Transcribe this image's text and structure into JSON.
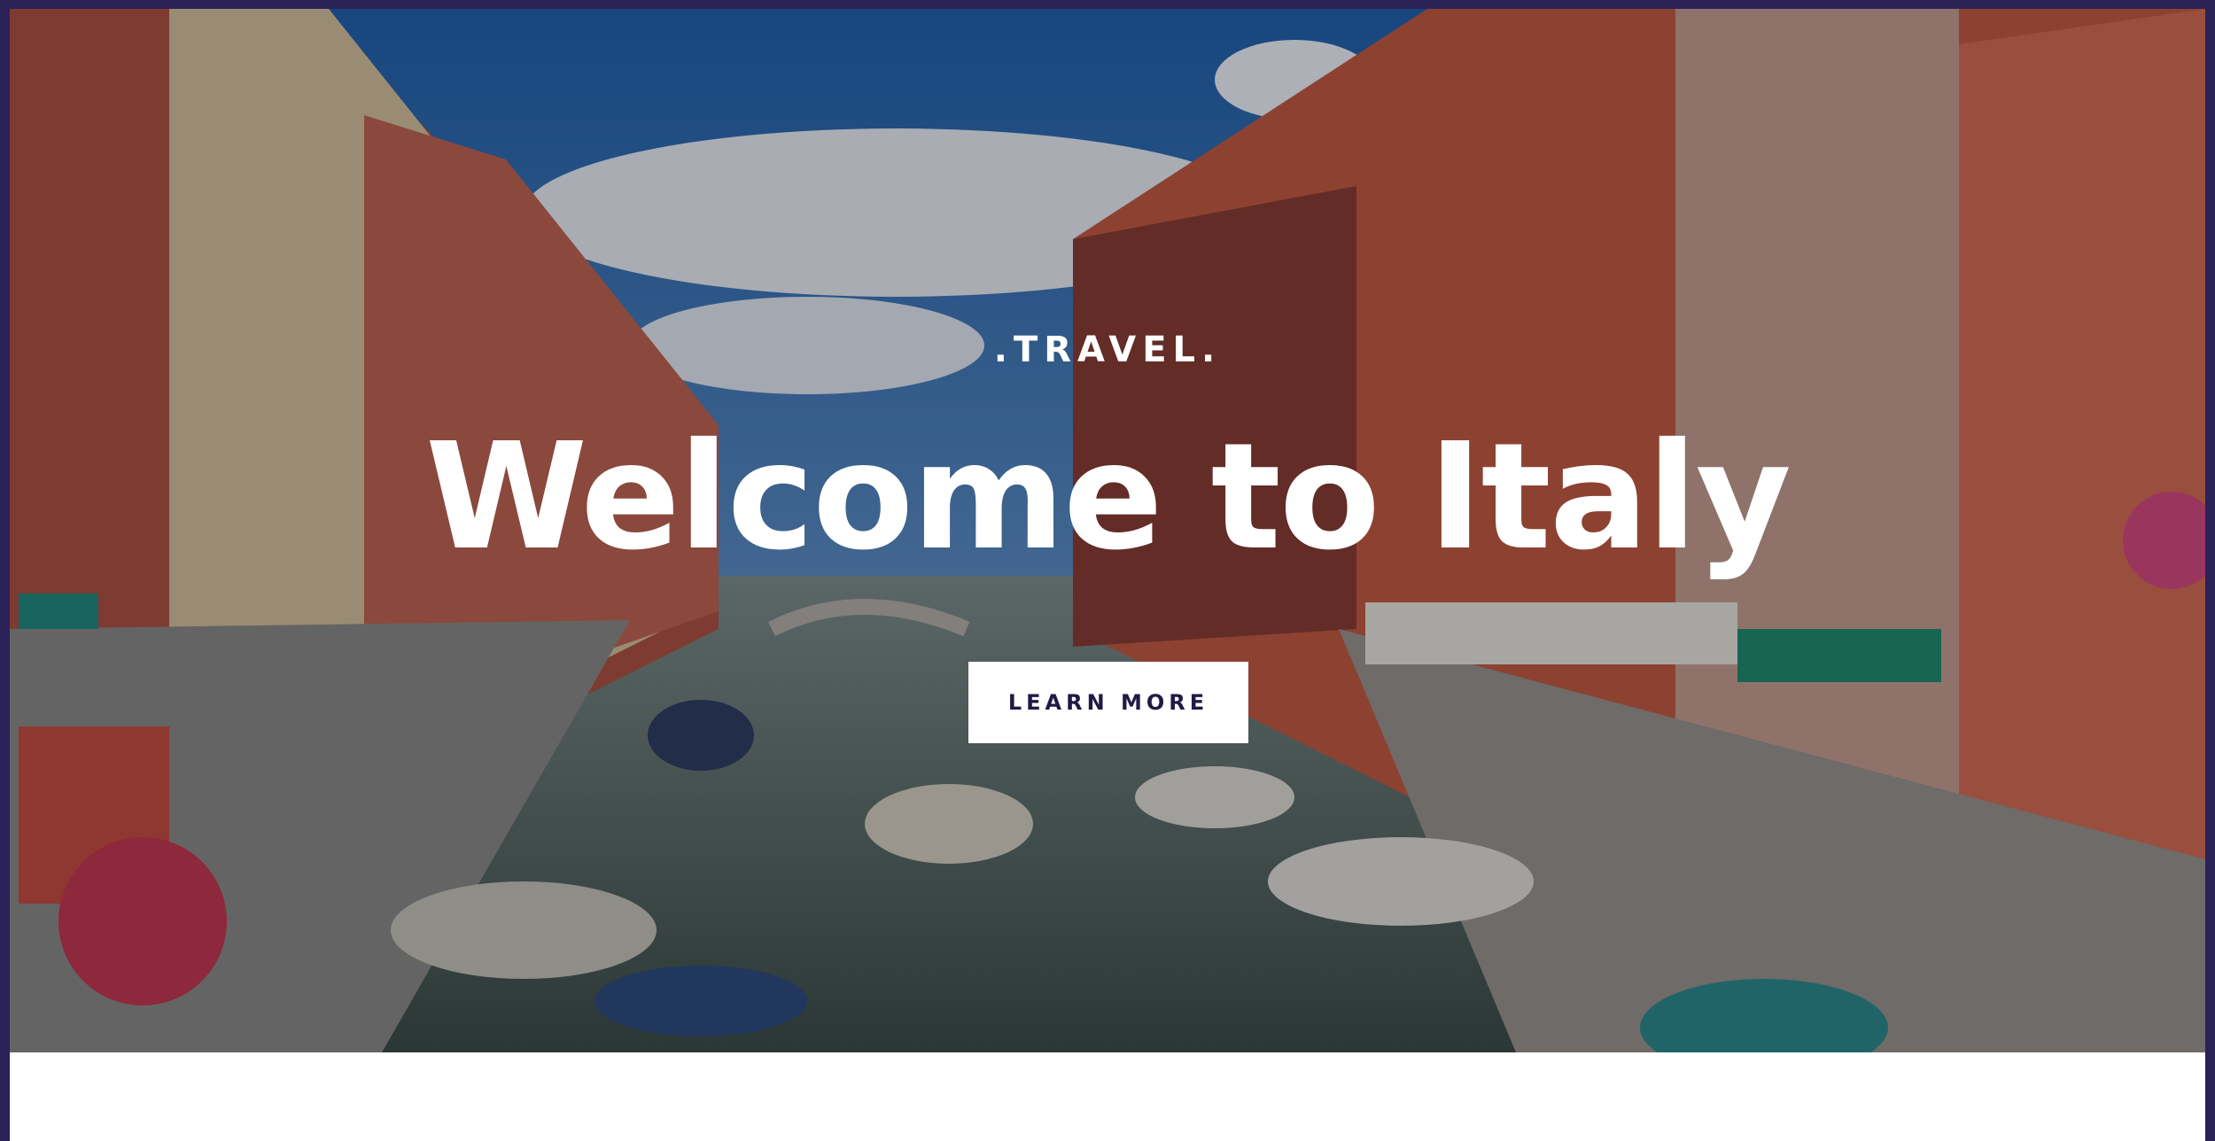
{
  "hero": {
    "kicker": ".TRAVEL.",
    "headline": "Welcome to Italy",
    "cta_label": "LEARN MORE",
    "background_image": "venice-canal-photo"
  },
  "colors": {
    "frame": "#2a2157",
    "cta_background": "#ffffff",
    "cta_text": "#1f1a45",
    "headline": "#ffffff"
  }
}
